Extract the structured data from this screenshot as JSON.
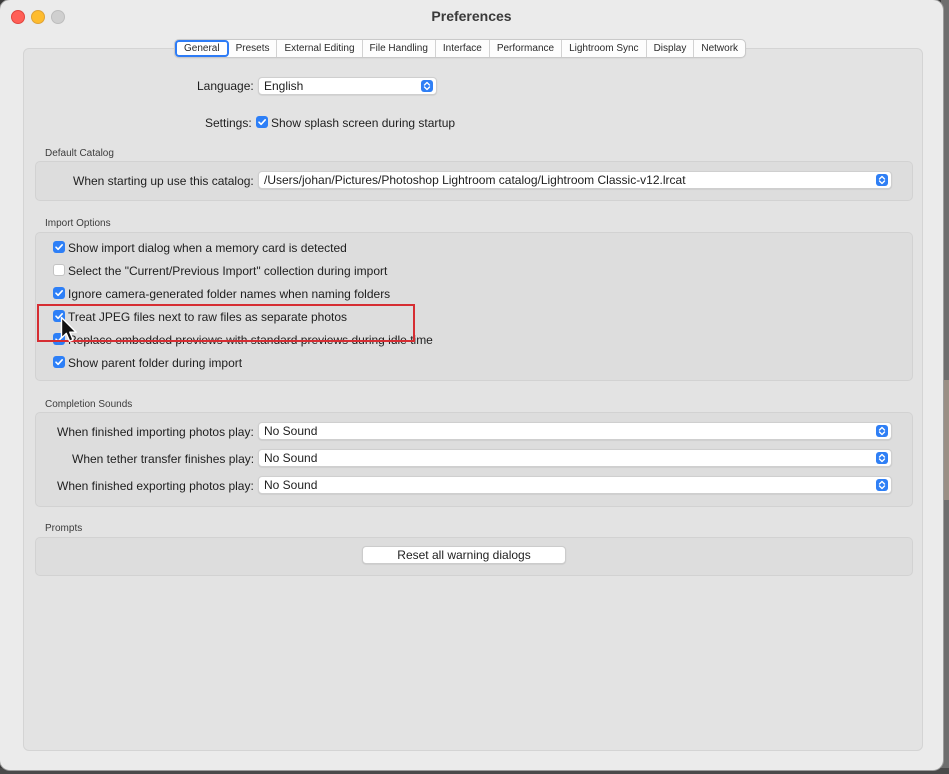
{
  "window": {
    "title": "Preferences"
  },
  "tabs": [
    {
      "label": "General",
      "active": true
    },
    {
      "label": "Presets"
    },
    {
      "label": "External Editing"
    },
    {
      "label": "File Handling"
    },
    {
      "label": "Interface"
    },
    {
      "label": "Performance"
    },
    {
      "label": "Lightroom Sync"
    },
    {
      "label": "Display"
    },
    {
      "label": "Network"
    }
  ],
  "general": {
    "language_label": "Language:",
    "language_value": "English",
    "settings_label": "Settings:",
    "splash_label": "Show splash screen during startup",
    "splash_checked": true
  },
  "default_catalog": {
    "title": "Default Catalog",
    "label": "When starting up use this catalog:",
    "value": "/Users/johan/Pictures/Photoshop Lightroom catalog/Lightroom Classic-v12.lrcat"
  },
  "import_options": {
    "title": "Import Options",
    "items": [
      {
        "label": "Show import dialog when a memory card is detected",
        "checked": true
      },
      {
        "label": "Select the \"Current/Previous Import\" collection during import",
        "checked": false
      },
      {
        "label": "Ignore camera-generated folder names when naming folders",
        "checked": true
      },
      {
        "label": "Treat JPEG files next to raw files as separate photos",
        "checked": true
      },
      {
        "label": "Replace embedded previews with standard previews during idle time",
        "checked": true
      },
      {
        "label": "Show parent folder during import",
        "checked": true
      }
    ]
  },
  "completion_sounds": {
    "title": "Completion Sounds",
    "rows": [
      {
        "label": "When finished importing photos play:",
        "value": "No Sound"
      },
      {
        "label": "When tether transfer finishes play:",
        "value": "No Sound"
      },
      {
        "label": "When finished exporting photos play:",
        "value": "No Sound"
      }
    ]
  },
  "prompts": {
    "title": "Prompts",
    "reset_button": "Reset all warning dialogs"
  },
  "colors": {
    "accent": "#2d7ff7",
    "highlight_box": "#d62d32"
  }
}
